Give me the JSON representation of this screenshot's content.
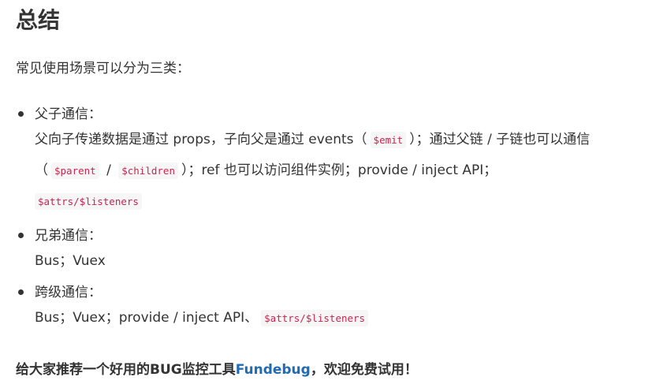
{
  "heading": "总结",
  "intro": "常见使用场景可以分为三类：",
  "sections": [
    {
      "title": "父子通信：",
      "t1": "父向子传递数据是通过 props，子向父是通过 events（",
      "c1": "$emit",
      "t2": "）；通过父链 / 子链也可以通信（",
      "c2": "$parent",
      "t3": " / ",
      "c3": "$children",
      "t4": "）；ref 也可以访问组件实例；provide / inject API；",
      "c4": "$attrs/$listeners"
    },
    {
      "title": "兄弟通信：",
      "t1": "Bus；Vuex"
    },
    {
      "title": "跨级通信：",
      "t1": "Bus；Vuex；provide / inject API、",
      "c1": "$attrs/$listeners"
    }
  ],
  "footer": {
    "prefix": "给大家推荐一个好用的BUG监控工具",
    "link": "Fundebug",
    "suffix": "，欢迎免费试用！"
  },
  "colors": {
    "text": "#333333",
    "code_text": "#c7254e",
    "code_bg": "#f6f6f6",
    "link": "#1e6bb8"
  },
  "icons": {
    "bullet": "bullet-dot-icon"
  }
}
